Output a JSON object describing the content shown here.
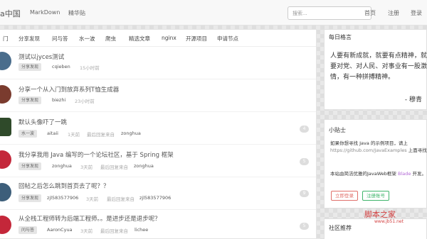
{
  "navbar": {
    "brand": "a中国",
    "links": [
      "MarkDown",
      "精华贴"
    ],
    "search_placeholder": "搜索...",
    "right_links": [
      "首页",
      "注册",
      "登录"
    ]
  },
  "tabs": [
    "门",
    "分享发现",
    "问与答",
    "水一波",
    "爬虫",
    "精选文章",
    "nginx",
    "开源项目",
    "申请节点"
  ],
  "topics": [
    {
      "title": "测试以jyces测试",
      "node": "分享发现",
      "author": "cqieben",
      "time": "15小时前",
      "last_reply_label": "",
      "last_reply_user": "",
      "count": "",
      "avatar_color": "#4a6d8c"
    },
    {
      "title": "分享一个从入门到放弃系列T恤生成器",
      "node": "分享发现",
      "author": "biezhi",
      "time": "23小时前",
      "last_reply_label": "",
      "last_reply_user": "",
      "count": "",
      "avatar_color": "#7a3b2e"
    },
    {
      "title": "默认头像吓了一跳",
      "node": "水一波",
      "author": "aitaii",
      "time": "1天前",
      "last_reply_label": "最后回复来自",
      "last_reply_user": "zonghua",
      "count": "4",
      "avatar_color": "#2f4a2a"
    },
    {
      "title": "我分享我用 Java 编写的一个论坛社区，基于 Spring 框架",
      "node": "分享发现",
      "author": "zonghua",
      "time": "3天前",
      "last_reply_label": "最后回复来自",
      "last_reply_user": "zonghua",
      "count": "5",
      "avatar_color": "#c4273a"
    },
    {
      "title": "回帖之后怎么跳到首页去了呢？？",
      "node": "分享发现",
      "author": "zjl583577906",
      "time": "3天前",
      "last_reply_label": "最后回复来自",
      "last_reply_user": "zjl583577906",
      "count": "9",
      "avatar_color": "#3d5e7a"
    },
    {
      "title": "从全栈工程师转为后端工程师。。是进步还是退步呢？",
      "node": "问与答",
      "author": "AaronCyua",
      "time": "3天前",
      "last_reply_label": "最后回复来自",
      "last_reply_user": "lichee",
      "count": "5",
      "avatar_color": "#c4273a"
    }
  ],
  "daily_quote": {
    "title": "每日格言",
    "text": "人要有新成就，就要有点精神，就要对党、对人民、对事业有一股激情，有一种拼搏精神。",
    "signature": "- 穆青"
  },
  "tips": {
    "title": "小贴士",
    "line1": "如果你想寻找 Java 的示例项目，请上",
    "url": "https://github.com/JavaExamples",
    "line1b": "上面寻找。",
    "line2a": "本站由简洁优雅的JavaWeb框架",
    "blade": "Blade",
    "line2b": "开发。",
    "login_button": "立即登录",
    "register_button": "注册账号"
  },
  "community": {
    "title": "社区推荐"
  },
  "watermark": {
    "text": "脚本之家",
    "url": "www.jb51.net"
  }
}
